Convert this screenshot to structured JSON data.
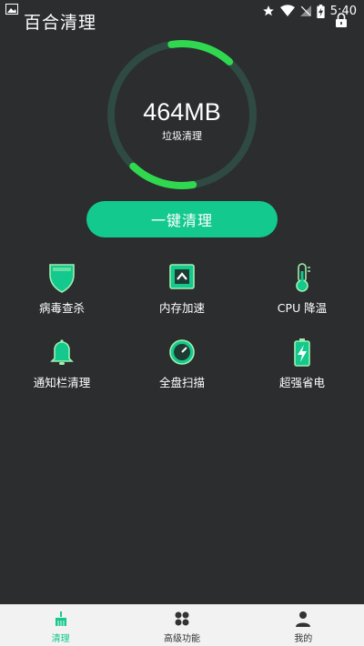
{
  "status_bar": {
    "time": "5:40"
  },
  "app": {
    "title": "百合清理"
  },
  "gauge": {
    "value": "464MB",
    "label": "垃圾清理"
  },
  "clean_button": {
    "label": "一键清理"
  },
  "features": [
    {
      "label": "病毒查杀",
      "icon": "shield-icon"
    },
    {
      "label": "内存加速",
      "icon": "memory-boost-icon"
    },
    {
      "label": "CPU 降温",
      "icon": "thermometer-icon"
    },
    {
      "label": "通知栏清理",
      "icon": "bell-icon"
    },
    {
      "label": "全盘扫描",
      "icon": "gauge-scan-icon"
    },
    {
      "label": "超强省电",
      "icon": "battery-icon"
    }
  ],
  "tabs": [
    {
      "label": "清理",
      "icon": "broom-icon",
      "active": true
    },
    {
      "label": "高级功能",
      "icon": "grid-icon",
      "active": false
    },
    {
      "label": "我的",
      "icon": "user-icon",
      "active": false
    }
  ],
  "colors": {
    "background": "#2b2d2e",
    "accent": "#13c98d",
    "gauge_green": "#2fd84f",
    "gauge_track": "#2f4a43",
    "tab_active": "#13c98d",
    "tab_inactive": "#333333"
  }
}
